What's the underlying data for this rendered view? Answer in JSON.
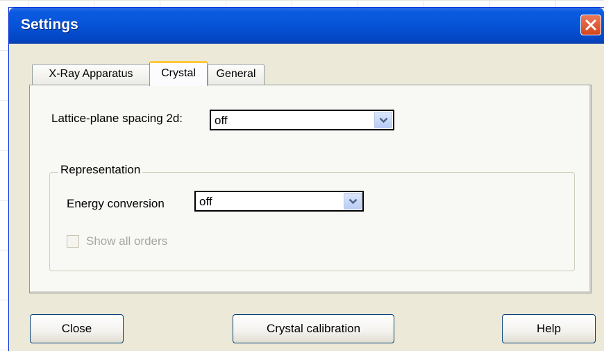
{
  "window": {
    "title": "Settings"
  },
  "tabs": [
    {
      "label": "X-Ray Apparatus",
      "active": false
    },
    {
      "label": "Crystal",
      "active": true
    },
    {
      "label": "General",
      "active": false
    }
  ],
  "crystal": {
    "lattice_label": "Lattice-plane spacing 2d:",
    "lattice_value": "off",
    "representation": {
      "legend": "Representation",
      "energy_label": "Energy conversion",
      "energy_value": "off",
      "show_orders_label": "Show all orders",
      "show_orders_checked": false,
      "show_orders_enabled": false
    }
  },
  "buttons": {
    "close_label": "Close",
    "calibration_label": "Crystal calibration",
    "help_label": "Help"
  },
  "colors": {
    "titlebar": "#0653d6",
    "close_button": "#d5451f",
    "dialog_bg": "#ece9d8",
    "active_tab_accent": "#ffc83c"
  }
}
